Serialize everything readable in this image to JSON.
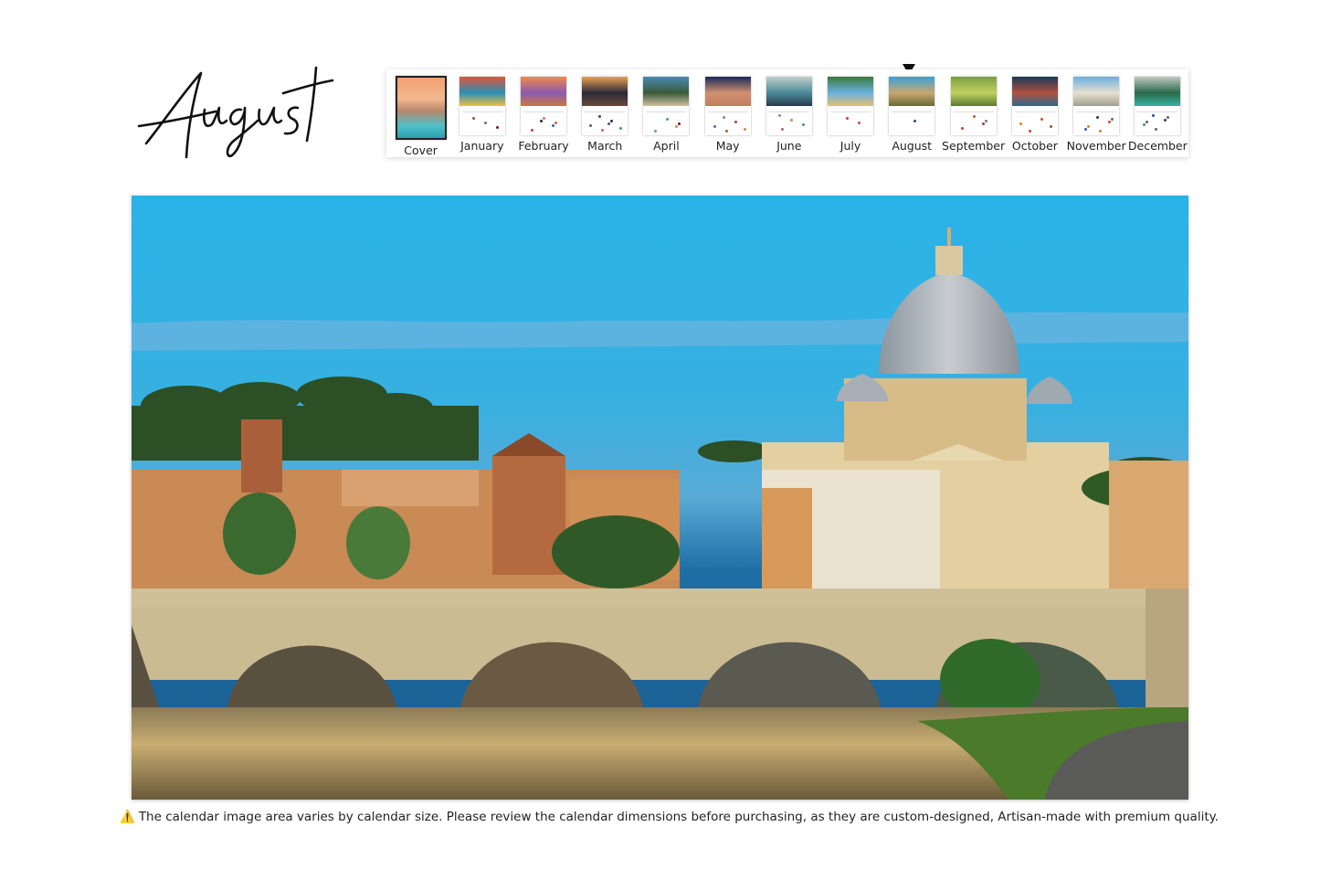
{
  "header": {
    "month_title": "August"
  },
  "thumbnail_strip": {
    "selected": "August",
    "items": [
      {
        "label": "Cover",
        "kind": "cover"
      },
      {
        "label": "January",
        "photo_colors": [
          "#e2543a",
          "#2a8fb8",
          "#f0c040"
        ],
        "dot_colors": [
          "#9a4b2a",
          "#8a6a7a",
          "#7a1030"
        ]
      },
      {
        "label": "February",
        "photo_colors": [
          "#f08a4a",
          "#8a5bb0",
          "#c87840"
        ],
        "dot_colors": [
          "#2a2a2a",
          "#2a6fb0",
          "#c84030",
          "#d87070",
          "#c86060"
        ]
      },
      {
        "label": "March",
        "photo_colors": [
          "#e8a050",
          "#2a2a3a",
          "#6a4a3a"
        ],
        "dot_colors": [
          "#3a5aa0",
          "#3a9a5a",
          "#7a2a4a",
          "#3a2a2a",
          "#4a6a5a",
          "#d86060"
        ]
      },
      {
        "label": "April",
        "photo_colors": [
          "#4a8ab0",
          "#3a5a3a",
          "#d0c0a0"
        ],
        "dot_colors": [
          "#c89050",
          "#6a9a8a",
          "#4a9a8a",
          "#7a1030"
        ]
      },
      {
        "label": "May",
        "photo_colors": [
          "#1a2a5a",
          "#d09070",
          "#c08060"
        ],
        "dot_colors": [
          "#c89050",
          "#6a9a8a",
          "#b04040",
          "#5a6ab0",
          "#a06040"
        ]
      },
      {
        "label": "June",
        "photo_colors": [
          "#c0d0c8",
          "#4a8a9a",
          "#2a3a4a"
        ],
        "dot_colors": [
          "#8a8a9a",
          "#d08050",
          "#4a9a6a",
          "#c06080"
        ]
      },
      {
        "label": "July",
        "photo_colors": [
          "#3a7a3a",
          "#6ab0e0",
          "#e0c070"
        ],
        "dot_colors": [
          "#c04040",
          "#c05060"
        ]
      },
      {
        "label": "August",
        "photo_colors": [
          "#3aa0d8",
          "#c8a870",
          "#6a6a3a"
        ],
        "dot_colors": [
          "#2a4a8a"
        ]
      },
      {
        "label": "September",
        "photo_colors": [
          "#7aa040",
          "#c0d060",
          "#5a7a30"
        ],
        "dot_colors": [
          "#8a4a3a",
          "#c84030",
          "#c06020",
          "#9a6a7a"
        ]
      },
      {
        "label": "October",
        "photo_colors": [
          "#1a3a5a",
          "#b05040",
          "#2a6a8a"
        ],
        "dot_colors": [
          "#9a4a3a",
          "#c84030",
          "#c05020",
          "#e08030"
        ]
      },
      {
        "label": "November",
        "photo_colors": [
          "#6ab0e0",
          "#e8e0d0",
          "#a0a090"
        ],
        "dot_colors": [
          "#3a5aa0",
          "#4a2a2a",
          "#c05040",
          "#e08030",
          "#c08040",
          "#5a6a7a"
        ]
      },
      {
        "label": "December",
        "photo_colors": [
          "#c0c8c0",
          "#2a6a4a",
          "#3ab0a0"
        ],
        "dot_colors": [
          "#2a4a9a",
          "#3a3a3a",
          "#4a8aa0",
          "#5a6a6a",
          "#5a6a6a",
          "#5a6a6a"
        ]
      }
    ]
  },
  "main_photo": {
    "subject": "St. Peter's Basilica and Ponte Sant'Angelo over the Tiber, Rome",
    "colors": {
      "sky_top": "#2ab3e8",
      "sky_bottom": "#1e6fa8",
      "cloud": "#5fa8d8",
      "stone": "#d9c7a0",
      "dome": "#a8adb3",
      "trees": "#2f5a2a",
      "water": "#c0a670"
    }
  },
  "notice": {
    "icon": "warning-icon",
    "text": "The calendar image area varies by calendar size. Please review the calendar dimensions before purchasing, as they are custom-designed, Artisan-made with premium quality."
  }
}
